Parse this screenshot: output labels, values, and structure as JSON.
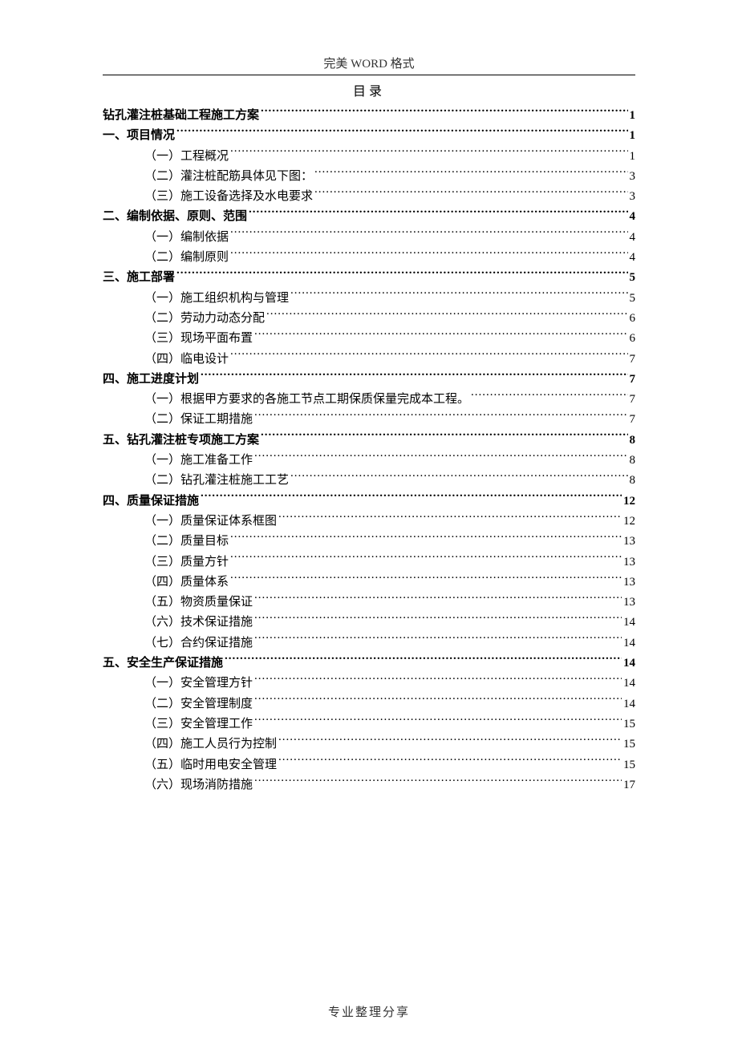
{
  "header": "完美 WORD 格式",
  "toc_title": "目录",
  "footer": "专业整理分享",
  "toc": [
    {
      "level": 0,
      "label": "钻孔灌注桩基础工程施工方案",
      "page": "1"
    },
    {
      "level": 0,
      "label": "一、项目情况",
      "page": "1"
    },
    {
      "level": 1,
      "label": "（一）工程概况",
      "page": "1"
    },
    {
      "level": 1,
      "label": "（二）灌注桩配筋具体见下图：",
      "page": "3"
    },
    {
      "level": 1,
      "label": "（三）施工设备选择及水电要求",
      "page": "3"
    },
    {
      "level": 0,
      "label": "二、编制依据、原则、范围",
      "page": "4"
    },
    {
      "level": 1,
      "label": "（一）编制依据",
      "page": "4"
    },
    {
      "level": 1,
      "label": "（二）编制原则",
      "page": "4"
    },
    {
      "level": 0,
      "label": "三、施工部署",
      "page": "5"
    },
    {
      "level": 1,
      "label": "（一）施工组织机构与管理",
      "page": "5"
    },
    {
      "level": 1,
      "label": "（二）劳动力动态分配",
      "page": "6"
    },
    {
      "level": 1,
      "label": "（三）现场平面布置",
      "page": "6"
    },
    {
      "level": 1,
      "label": "（四）临电设计",
      "page": "7"
    },
    {
      "level": 0,
      "label": "四、施工进度计划",
      "page": "7"
    },
    {
      "level": 1,
      "label": "（一）根据甲方要求的各施工节点工期保质保量完成本工程。",
      "page": "7"
    },
    {
      "level": 1,
      "label": "（二）保证工期措施",
      "page": "7"
    },
    {
      "level": 0,
      "label": "五、钻孔灌注桩专项施工方案",
      "page": "8"
    },
    {
      "level": 1,
      "label": "（一）施工准备工作",
      "page": "8"
    },
    {
      "level": 1,
      "label": "（二）钻孔灌注桩施工工艺",
      "page": "8"
    },
    {
      "level": 0,
      "label": "四、质量保证措施",
      "page": "12"
    },
    {
      "level": 1,
      "label": "（一）质量保证体系框图",
      "page": "12"
    },
    {
      "level": 1,
      "label": "（二）质量目标",
      "page": "13"
    },
    {
      "level": 1,
      "label": "（三）质量方针",
      "page": "13"
    },
    {
      "level": 1,
      "label": "（四）质量体系",
      "page": "13"
    },
    {
      "level": 1,
      "label": "（五）物资质量保证",
      "page": "13"
    },
    {
      "level": 1,
      "label": "（六）技术保证措施",
      "page": "14"
    },
    {
      "level": 1,
      "label": "（七）合约保证措施",
      "page": "14"
    },
    {
      "level": 0,
      "label": "五、安全生产保证措施",
      "page": "14"
    },
    {
      "level": 1,
      "label": "（一）安全管理方针",
      "page": "14"
    },
    {
      "level": 1,
      "label": "（二）安全管理制度",
      "page": "14"
    },
    {
      "level": 1,
      "label": "（三）安全管理工作",
      "page": "15"
    },
    {
      "level": 1,
      "label": "（四）施工人员行为控制",
      "page": "15"
    },
    {
      "level": 1,
      "label": "（五）临时用电安全管理",
      "page": "15"
    },
    {
      "level": 1,
      "label": "（六）现场消防措施",
      "page": "17"
    }
  ]
}
